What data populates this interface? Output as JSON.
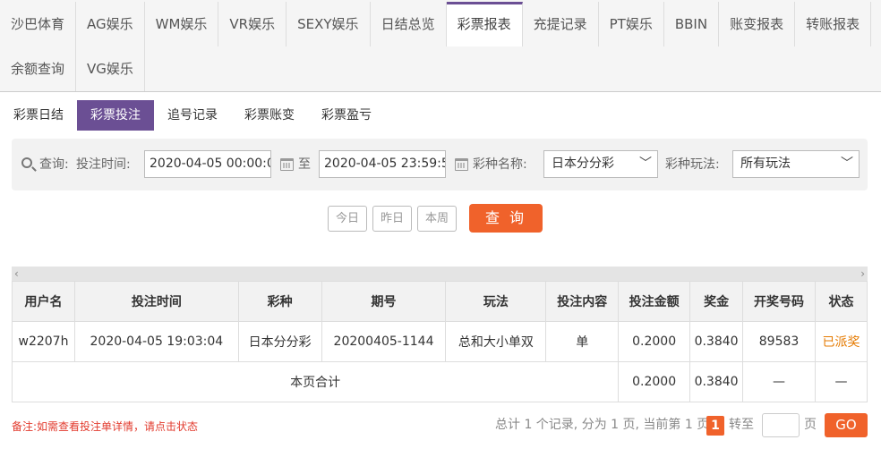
{
  "top_tabs_row1": [
    "沙巴体育",
    "AG娱乐",
    "WM娱乐",
    "VR娱乐",
    "SEXY娱乐",
    "日结总览",
    "彩票报表",
    "充提记录",
    "PT娱乐",
    "BBIN",
    "账变报表",
    "转账报表"
  ],
  "top_tabs_row2": [
    "余额查询",
    "VG娱乐"
  ],
  "active_top_tab": "彩票报表",
  "sub_tabs": [
    "彩票日结",
    "彩票投注",
    "追号记录",
    "彩票账变",
    "彩票盈亏"
  ],
  "active_sub_tab": "彩票投注",
  "search": {
    "query_label": "查询:",
    "time_label": "投注时间:",
    "start_time": "2020-04-05 00:00:00",
    "to_label": "至",
    "end_time": "2020-04-05 23:59:59",
    "lottery_label": "彩种名称:",
    "lottery_value": "日本分分彩",
    "play_label": "彩种玩法:",
    "play_value": "所有玩法"
  },
  "quick": {
    "today": "今日",
    "yesterday": "昨日",
    "week": "本周",
    "submit": "查 询"
  },
  "table": {
    "headers": [
      "用户名",
      "投注时间",
      "彩种",
      "期号",
      "玩法",
      "投注内容",
      "投注金额",
      "奖金",
      "开奖号码",
      "状态"
    ],
    "row": [
      "w2207h",
      "2020-04-05 19:03:04",
      "日本分分彩",
      "20200405-1144",
      "总和大小单双",
      "单",
      "0.2000",
      "0.3840",
      "89583",
      "已派奖"
    ],
    "total_label": "本页合计",
    "total_amount": "0.2000",
    "total_bonus": "0.3840",
    "total_dash1": "—",
    "total_dash2": "—"
  },
  "note": "备注:如需查看投注单详情，请点击状态",
  "pager": {
    "summary": "总计 1 个记录, 分为 1 页, 当前第 1 页",
    "current_page": "1",
    "goto_label": "转至",
    "page_unit": "页",
    "go_button": "GO"
  },
  "colors": {
    "accent": "#6b4f94",
    "orange": "#f0622b",
    "status": "#e57a00",
    "note": "#e23b2e"
  }
}
